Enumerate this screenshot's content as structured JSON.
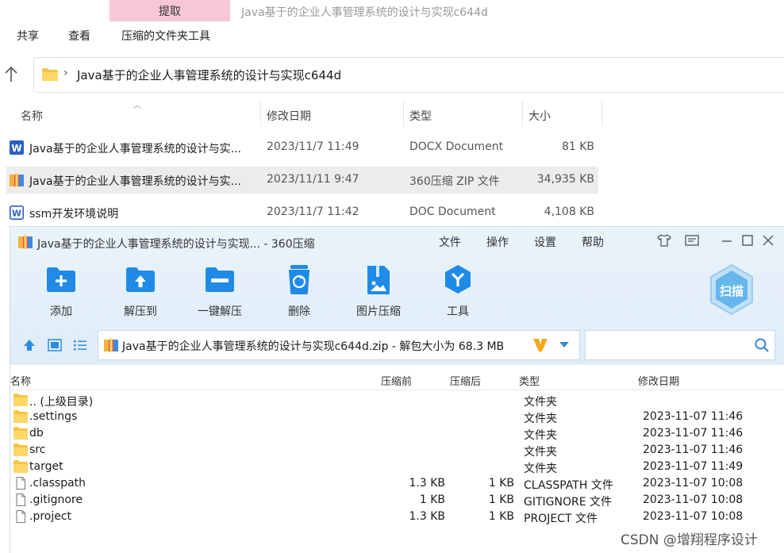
{
  "ribbon": {
    "context_tab": "提取",
    "window_title": "Java基于的企业人事管理系统的设计与实现c644d",
    "tabs": [
      "共享",
      "查看",
      "压缩的文件夹工具"
    ]
  },
  "address": {
    "path": "Java基于的企业人事管理系统的设计与实现c644d"
  },
  "explorer": {
    "columns": [
      "名称",
      "修改日期",
      "类型",
      "大小"
    ],
    "files": [
      {
        "name": "Java基于的企业人事管理系统的设计与实...",
        "date": "2023/11/7 11:49",
        "type": "DOCX Document",
        "size": "81 KB",
        "icon": "word-doc-icon"
      },
      {
        "name": "Java基于的企业人事管理系统的设计与实...",
        "date": "2023/11/11 9:47",
        "type": "360压缩 ZIP 文件",
        "size": "34,935 KB",
        "icon": "zip-archive-icon"
      },
      {
        "name": "ssm开发环境说明",
        "date": "2023/11/7 11:42",
        "type": "DOC Document",
        "size": "4,108 KB",
        "icon": "word-doc-outline-icon"
      }
    ]
  },
  "zip": {
    "title": "Java基于的企业人事管理系统的设计与实现... - 360压缩",
    "menu": [
      "文件",
      "操作",
      "设置",
      "帮助"
    ],
    "tools": [
      "添加",
      "解压到",
      "一键解压",
      "删除",
      "图片压缩",
      "工具"
    ],
    "scan_label": "扫描",
    "address": "Java基于的企业人事管理系统的设计与实现c644d.zip - 解包大小为 68.3 MB",
    "columns": [
      "名称",
      "压缩前",
      "压缩后",
      "类型",
      "修改日期"
    ],
    "entries": [
      {
        "name": ".. (上级目录)",
        "before": "",
        "after": "",
        "type": "文件夹",
        "date": "",
        "kind": "folder"
      },
      {
        "name": ".settings",
        "before": "",
        "after": "",
        "type": "文件夹",
        "date": "2023-11-07 11:46",
        "kind": "folder"
      },
      {
        "name": "db",
        "before": "",
        "after": "",
        "type": "文件夹",
        "date": "2023-11-07 11:46",
        "kind": "folder"
      },
      {
        "name": "src",
        "before": "",
        "after": "",
        "type": "文件夹",
        "date": "2023-11-07 11:46",
        "kind": "folder"
      },
      {
        "name": "target",
        "before": "",
        "after": "",
        "type": "文件夹",
        "date": "2023-11-07 11:49",
        "kind": "folder"
      },
      {
        "name": ".classpath",
        "before": "1.3 KB",
        "after": "1 KB",
        "type": "CLASSPATH 文件",
        "date": "2023-11-07 10:08",
        "kind": "file"
      },
      {
        "name": ".gitignore",
        "before": "1 KB",
        "after": "1 KB",
        "type": "GITIGNORE 文件",
        "date": "2023-11-07 10:08",
        "kind": "file"
      },
      {
        "name": ".project",
        "before": "1.3 KB",
        "after": "1 KB",
        "type": "PROJECT 文件",
        "date": "2023-11-07 10:08",
        "kind": "file"
      }
    ]
  },
  "watermark": "CSDN @增翔程序设计",
  "colors": {
    "accent": "#1a8ee8",
    "context_tab": "#f7c6d8",
    "selection": "#ececec"
  }
}
